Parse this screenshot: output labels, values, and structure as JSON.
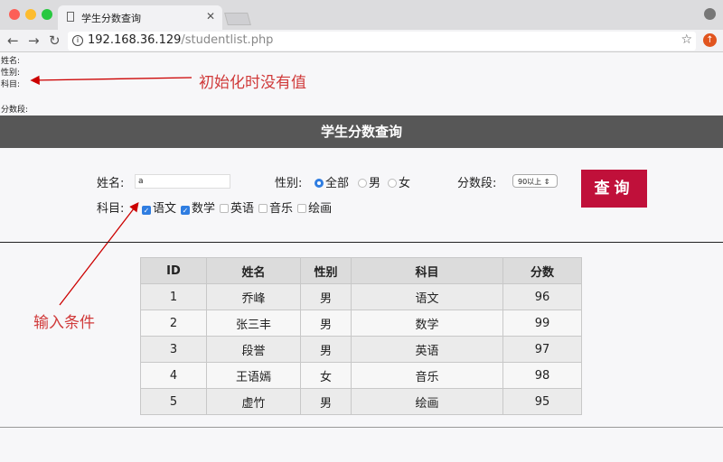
{
  "browser": {
    "tab_title": "学生分数查询",
    "url_host": "192.168.36.129",
    "url_path": "/studentlist.php"
  },
  "debug": {
    "name": "姓名:",
    "gender": "性别:",
    "subject": "科目:",
    "range": "分数段:"
  },
  "annotations": {
    "top": "初始化时没有值",
    "left": "输入条件"
  },
  "page_title": "学生分数查询",
  "form": {
    "name_label": "姓名:",
    "name_value": "a",
    "gender_label": "性别:",
    "gender_options": [
      "全部",
      "男",
      "女"
    ],
    "gender_selected": "全部",
    "range_label": "分数段:",
    "range_value": "90以上",
    "subject_label": "科目:",
    "subjects": [
      {
        "label": "语文",
        "checked": true
      },
      {
        "label": "数学",
        "checked": true
      },
      {
        "label": "英语",
        "checked": false
      },
      {
        "label": "音乐",
        "checked": false
      },
      {
        "label": "绘画",
        "checked": false
      }
    ],
    "submit": "查询"
  },
  "table": {
    "headers": [
      "ID",
      "姓名",
      "性别",
      "科目",
      "分数"
    ],
    "rows": [
      [
        "1",
        "乔峰",
        "男",
        "语文",
        "96"
      ],
      [
        "2",
        "张三丰",
        "男",
        "数学",
        "99"
      ],
      [
        "3",
        "段誉",
        "男",
        "英语",
        "97"
      ],
      [
        "4",
        "王语嫣",
        "女",
        "音乐",
        "98"
      ],
      [
        "5",
        "虚竹",
        "男",
        "绘画",
        "95"
      ]
    ]
  }
}
